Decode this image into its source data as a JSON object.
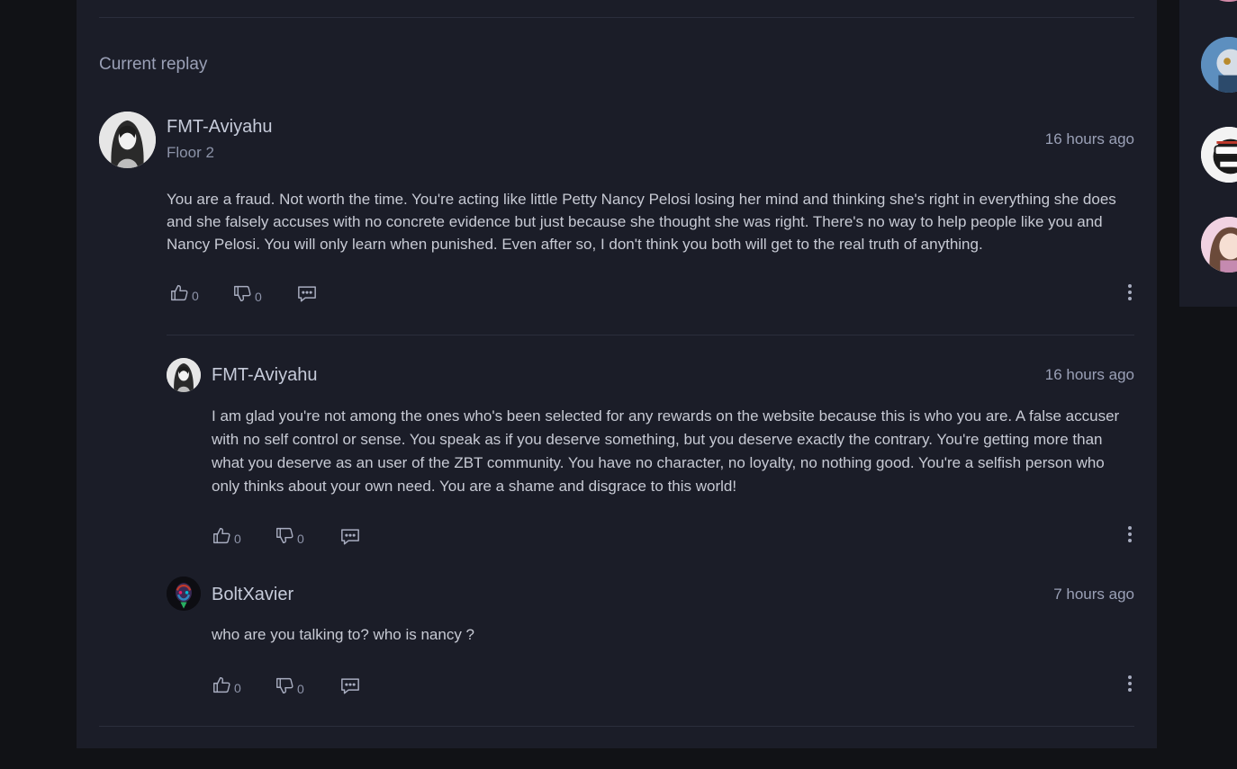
{
  "section": {
    "title": "Current replay"
  },
  "main_comment": {
    "author": "FMT-Aviyahu",
    "floor": "Floor 2",
    "time": "16 hours ago",
    "text": "You are a fraud. Not worth the time. You're acting like little Petty Nancy Pelosi losing her mind and thinking she's right in everything she does and she falsely accuses with no concrete evidence but just because she thought she was right. There's no way to help people like you and Nancy Pelosi. You will only learn when punished. Even after so, I don't think you both will get to the real truth of anything.",
    "likes": "0",
    "dislikes": "0"
  },
  "replies": [
    {
      "author": "FMT-Aviyahu",
      "time": "16 hours ago",
      "text": "I am glad you're not among the ones who's been selected for any rewards on the website because this is who you are. A false accuser with no self control or sense. You speak as if you deserve something, but you deserve exactly the contrary. You're getting more than what you deserve as an user of the ZBT community. You have no character, no loyalty, no nothing good. You're a selfish person who only thinks about your own need. You are a shame and disgrace to this world!",
      "likes": "0",
      "dislikes": "0"
    },
    {
      "author": "BoltXavier",
      "time": "7 hours ago",
      "text": "who are you talking to? who is nancy ?",
      "likes": "0",
      "dislikes": "0"
    }
  ],
  "icons": {
    "like": "thumbs-up-icon",
    "dislike": "thumbs-down-icon",
    "reply": "comment-icon",
    "more": "more-vertical-icon"
  },
  "colors": {
    "background": "#111216",
    "panel": "#1b1d28",
    "divider": "#2b2e3c",
    "text": "#c7cad4",
    "muted": "#9aa0b6"
  }
}
